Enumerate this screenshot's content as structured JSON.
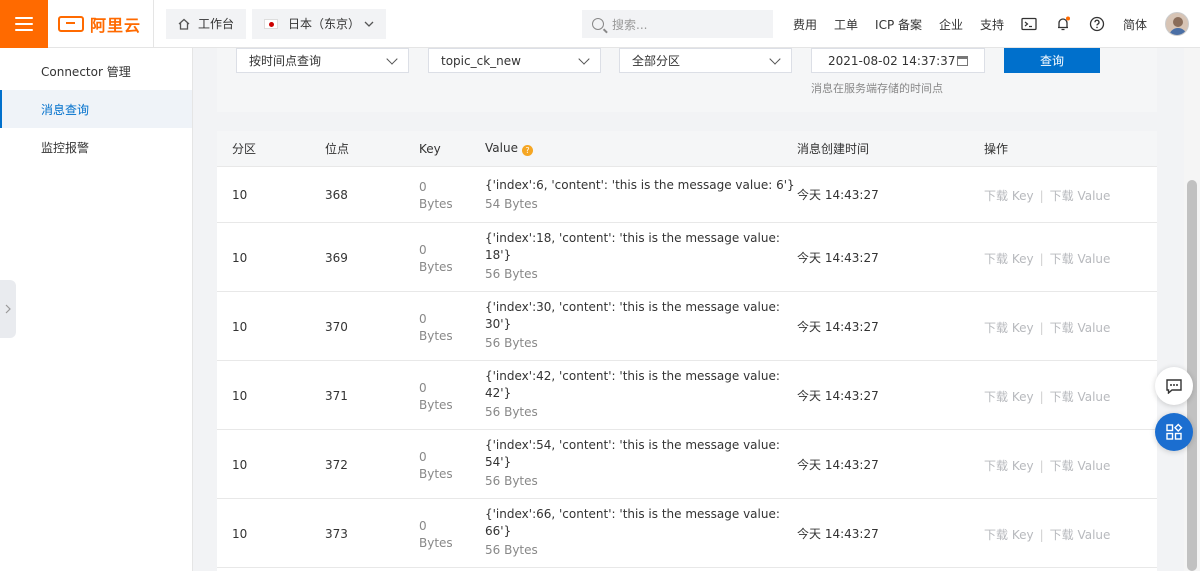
{
  "topbar": {
    "brand": "阿里云",
    "workbench_label": "工作台",
    "region_label": "日本（东京）",
    "search_placeholder": "搜索...",
    "nav_links": [
      "费用",
      "工单",
      "ICP 备案",
      "企业",
      "支持"
    ],
    "language_label": "简体"
  },
  "sidebar": {
    "items": [
      {
        "label": "Connector 管理"
      },
      {
        "label": "消息查询"
      },
      {
        "label": "监控报警"
      }
    ]
  },
  "filters": {
    "query_mode": "按时间点查询",
    "topic": "topic_ck_new",
    "partition": "全部分区",
    "datetime": "2021-08-02 14:37:37",
    "query_button": "查询",
    "hint": "消息在服务端存储的时间点"
  },
  "table": {
    "headers": {
      "partition": "分区",
      "offset": "位点",
      "key": "Key",
      "value": "Value",
      "created": "消息创建时间",
      "actions": "操作"
    },
    "action_labels": {
      "download_key": "下载 Key",
      "download_value": "下载 Value",
      "separator": "|"
    },
    "rows": [
      {
        "partition": "10",
        "offset": "368",
        "key_num": "0",
        "key_unit": "Bytes",
        "value_line1": "{'index':6, 'content': 'this is the message value: 6'}",
        "value_line2": "",
        "value_size": "54 Bytes",
        "created": "今天 14:43:27"
      },
      {
        "partition": "10",
        "offset": "369",
        "key_num": "0",
        "key_unit": "Bytes",
        "value_line1": "{'index':18, 'content': 'this is the message value:",
        "value_line2": "18'}",
        "value_size": "56 Bytes",
        "created": "今天 14:43:27"
      },
      {
        "partition": "10",
        "offset": "370",
        "key_num": "0",
        "key_unit": "Bytes",
        "value_line1": "{'index':30, 'content': 'this is the message value:",
        "value_line2": "30'}",
        "value_size": "56 Bytes",
        "created": "今天 14:43:27"
      },
      {
        "partition": "10",
        "offset": "371",
        "key_num": "0",
        "key_unit": "Bytes",
        "value_line1": "{'index':42, 'content': 'this is the message value:",
        "value_line2": "42'}",
        "value_size": "56 Bytes",
        "created": "今天 14:43:27"
      },
      {
        "partition": "10",
        "offset": "372",
        "key_num": "0",
        "key_unit": "Bytes",
        "value_line1": "{'index':54, 'content': 'this is the message value:",
        "value_line2": "54'}",
        "value_size": "56 Bytes",
        "created": "今天 14:43:27"
      },
      {
        "partition": "10",
        "offset": "373",
        "key_num": "0",
        "key_unit": "Bytes",
        "value_line1": "{'index':66, 'content': 'this is the message value:",
        "value_line2": "66'}",
        "value_size": "56 Bytes",
        "created": "今天 14:43:27"
      }
    ]
  },
  "colors": {
    "brand": "#ff6a00",
    "primary": "#0070cc",
    "help": "#f5a623",
    "notification": "#ff6a00"
  },
  "icons": [
    "menu-icon",
    "home-icon",
    "flag-icon",
    "search-icon",
    "terminal-icon",
    "bell-icon",
    "help-icon",
    "chat-icon",
    "apps-icon",
    "chevron-right-icon",
    "calendar-icon"
  ]
}
